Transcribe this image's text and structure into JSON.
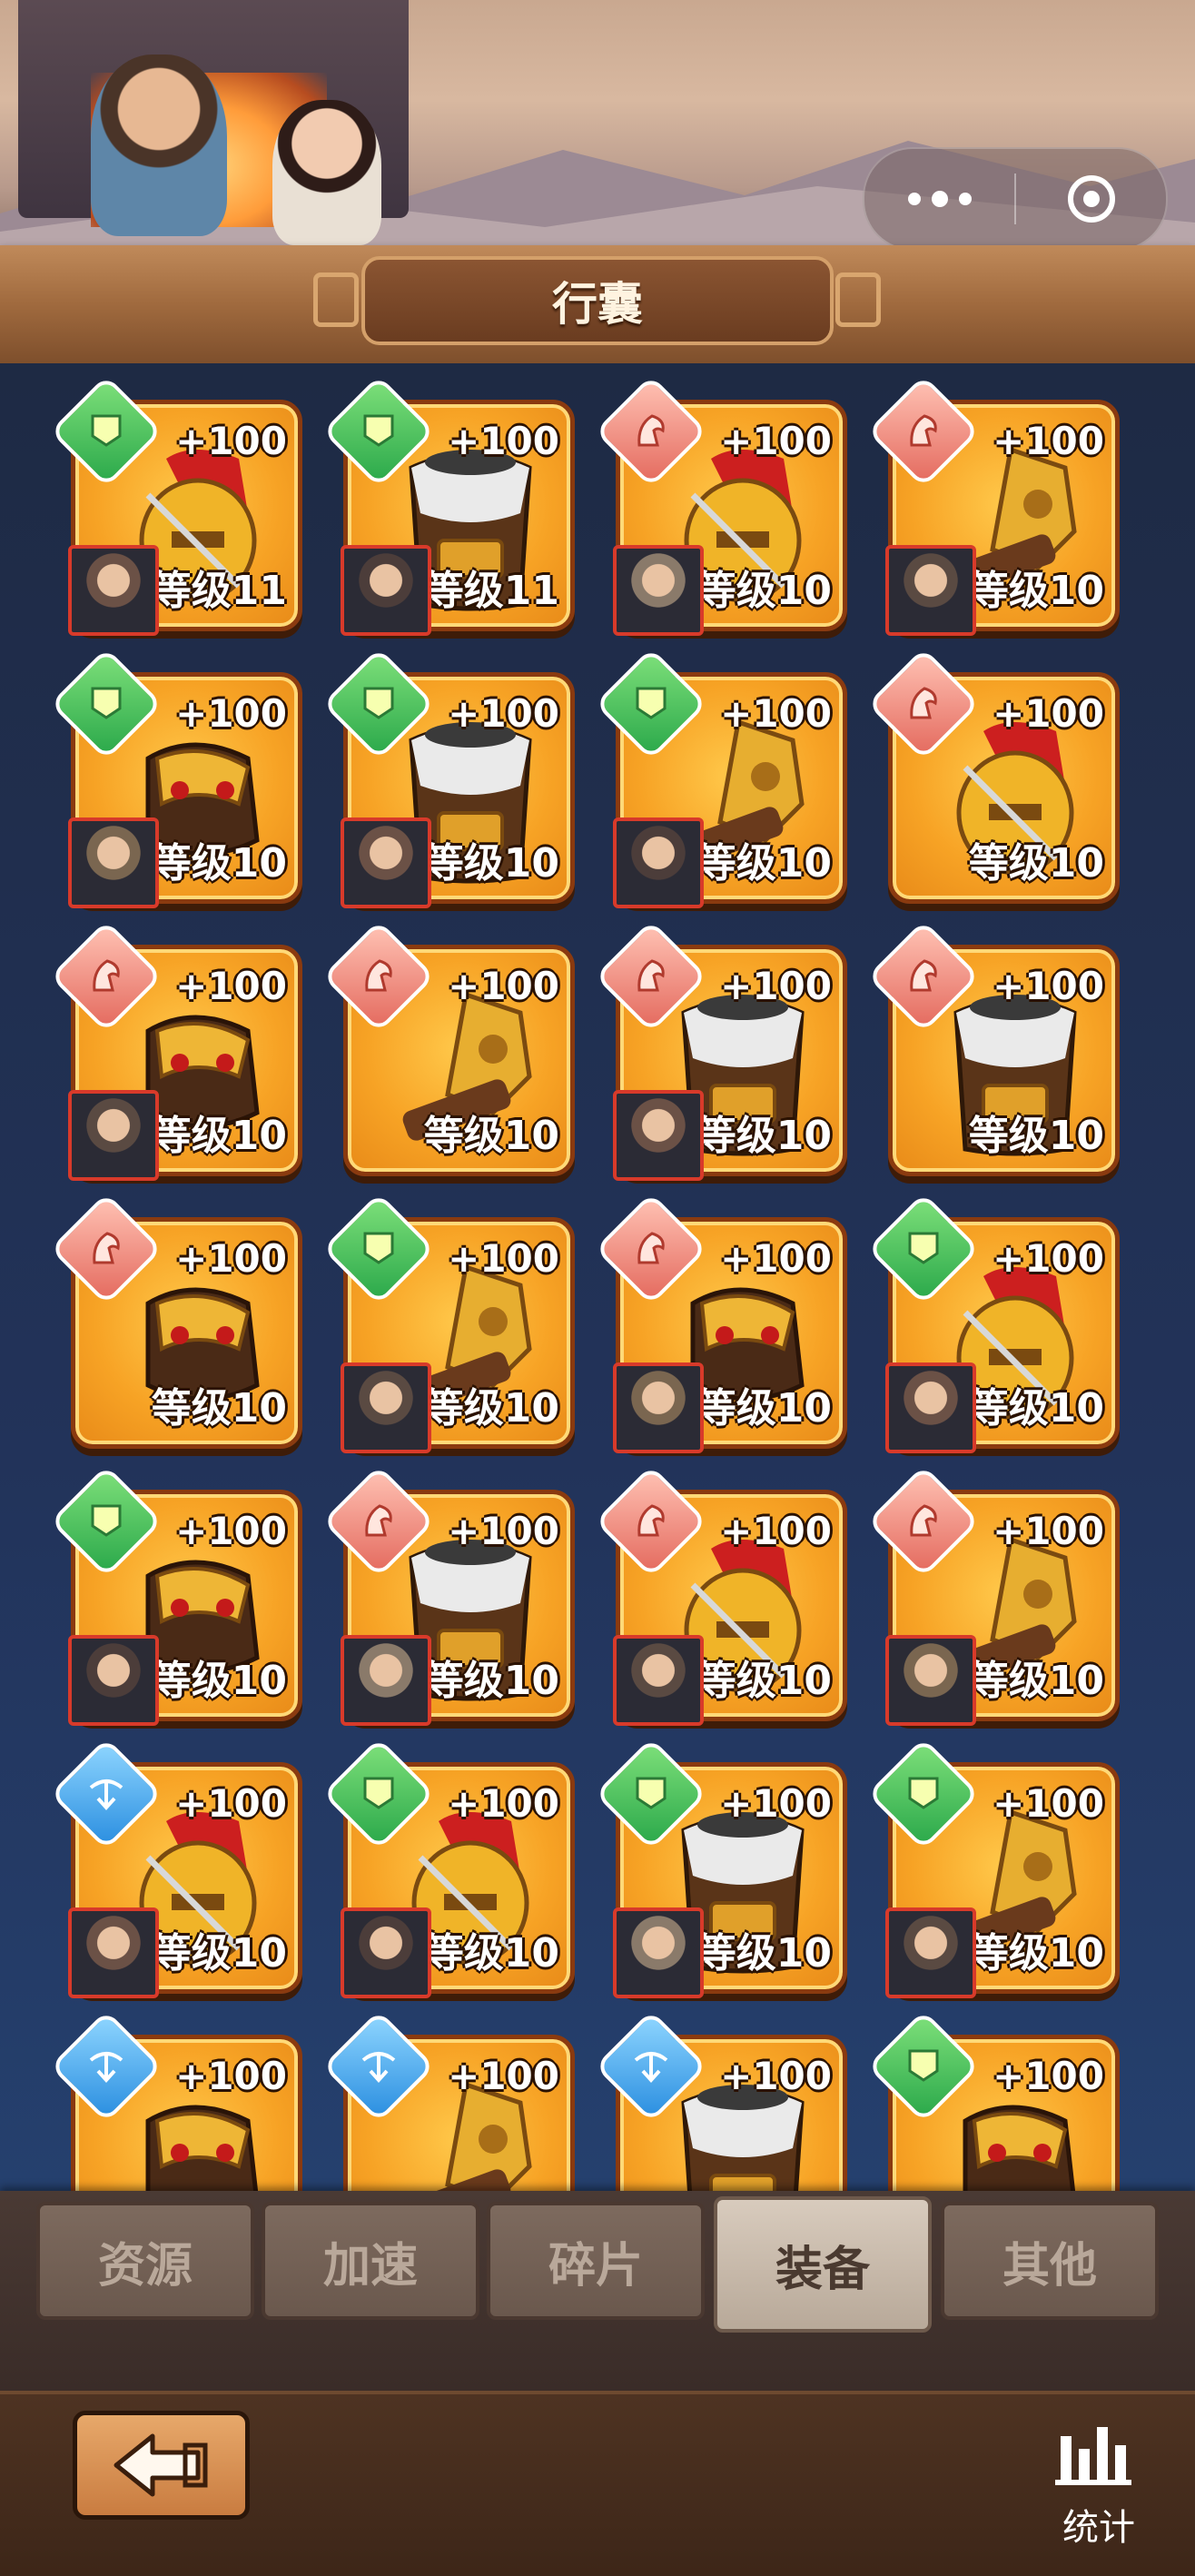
{
  "header": {
    "title": "行囊"
  },
  "capsule": {
    "more_icon": "more-dots-icon",
    "close_icon": "target-close-icon"
  },
  "items": [
    {
      "badge": "green",
      "art": "helmet",
      "qty": "+100",
      "level": "等级11",
      "hero": true
    },
    {
      "badge": "green",
      "art": "armor",
      "qty": "+100",
      "level": "等级11",
      "hero": true
    },
    {
      "badge": "red",
      "art": "helmet",
      "qty": "+100",
      "level": "等级10",
      "hero": true
    },
    {
      "badge": "red",
      "art": "weapon",
      "qty": "+100",
      "level": "等级10",
      "hero": true
    },
    {
      "badge": "green",
      "art": "boots",
      "qty": "+100",
      "level": "等级10",
      "hero": true
    },
    {
      "badge": "green",
      "art": "armor",
      "qty": "+100",
      "level": "等级10",
      "hero": true
    },
    {
      "badge": "green",
      "art": "weapon",
      "qty": "+100",
      "level": "等级10",
      "hero": true
    },
    {
      "badge": "red",
      "art": "helmet",
      "qty": "+100",
      "level": "等级10",
      "hero": false
    },
    {
      "badge": "red",
      "art": "boots",
      "qty": "+100",
      "level": "等级10",
      "hero": true
    },
    {
      "badge": "red",
      "art": "weapon",
      "qty": "+100",
      "level": "等级10",
      "hero": false
    },
    {
      "badge": "red",
      "art": "armor",
      "qty": "+100",
      "level": "等级10",
      "hero": true
    },
    {
      "badge": "red",
      "art": "armor",
      "qty": "+100",
      "level": "等级10",
      "hero": false
    },
    {
      "badge": "red",
      "art": "boots",
      "qty": "+100",
      "level": "等级10",
      "hero": false
    },
    {
      "badge": "green",
      "art": "weapon",
      "qty": "+100",
      "level": "等级10",
      "hero": true
    },
    {
      "badge": "red",
      "art": "boots",
      "qty": "+100",
      "level": "等级10",
      "hero": true
    },
    {
      "badge": "green",
      "art": "helmet",
      "qty": "+100",
      "level": "等级10",
      "hero": true
    },
    {
      "badge": "green",
      "art": "boots",
      "qty": "+100",
      "level": "等级10",
      "hero": true
    },
    {
      "badge": "red",
      "art": "armor",
      "qty": "+100",
      "level": "等级10",
      "hero": true
    },
    {
      "badge": "red",
      "art": "helmet",
      "qty": "+100",
      "level": "等级10",
      "hero": true
    },
    {
      "badge": "red",
      "art": "weapon",
      "qty": "+100",
      "level": "等级10",
      "hero": true
    },
    {
      "badge": "blue",
      "art": "helmet",
      "qty": "+100",
      "level": "等级10",
      "hero": true
    },
    {
      "badge": "green",
      "art": "helmet",
      "qty": "+100",
      "level": "等级10",
      "hero": true
    },
    {
      "badge": "green",
      "art": "armor",
      "qty": "+100",
      "level": "等级10",
      "hero": true
    },
    {
      "badge": "green",
      "art": "weapon",
      "qty": "+100",
      "level": "等级10",
      "hero": true
    },
    {
      "badge": "blue",
      "art": "boots",
      "qty": "+100",
      "level": "",
      "hero": false
    },
    {
      "badge": "blue",
      "art": "weapon",
      "qty": "+100",
      "level": "",
      "hero": false
    },
    {
      "badge": "blue",
      "art": "armor",
      "qty": "+100",
      "level": "",
      "hero": false
    },
    {
      "badge": "green",
      "art": "boots",
      "qty": "+100",
      "level": "",
      "hero": false
    }
  ],
  "tabs": [
    {
      "label": "资源",
      "active": false
    },
    {
      "label": "加速",
      "active": false
    },
    {
      "label": "碎片",
      "active": false
    },
    {
      "label": "装备",
      "active": true
    },
    {
      "label": "其他",
      "active": false
    }
  ],
  "footer": {
    "stats_label": "统计",
    "back_icon": "back-arrow-icon",
    "stats_icon": "bar-chart-icon"
  },
  "colors": {
    "card_gold": "#f7a325",
    "card_border": "#8a3a0f",
    "badge_green": "#2aa84a",
    "badge_red": "#e46a5e",
    "badge_blue": "#2a8ee0",
    "panel_bg": "#1e2a44"
  }
}
